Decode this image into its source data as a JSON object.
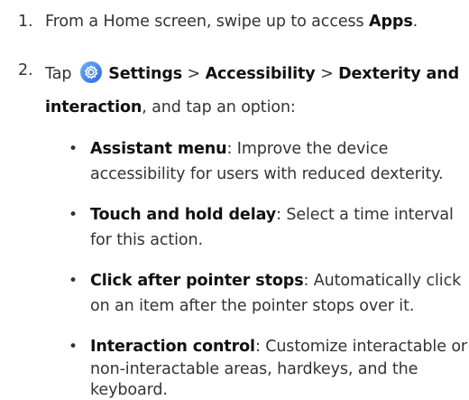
{
  "steps": [
    {
      "number": "1.",
      "text_before": "From a Home screen, swipe up to access ",
      "bold": "Apps",
      "text_after": "."
    },
    {
      "number": "2.",
      "tap": "Tap",
      "settings": "Settings",
      "sep1": ">",
      "accessibility": "Accessibility",
      "sep2": ">",
      "dexterity_line1": "Dexterity and",
      "dexterity_line2": "interaction",
      "tail": ", and tap an option:"
    }
  ],
  "icon": {
    "name": "settings-gear-icon",
    "color": "#3d7df6"
  },
  "options": [
    {
      "bullet": "•",
      "title": "Assistant menu",
      "lines": [
        ": Improve the device",
        "accessibility for users with reduced dexterity."
      ]
    },
    {
      "bullet": "•",
      "title": "Touch and hold delay",
      "lines": [
        ": Select a time interval",
        "for this action."
      ]
    },
    {
      "bullet": "•",
      "title": "Click after pointer stops",
      "lines": [
        ": Automatically click",
        "on an item after the pointer stops over it."
      ]
    },
    {
      "bullet": "•",
      "title": "Interaction control",
      "lines": [
        ": Customize interactable or",
        "non-interactable areas, hardkeys, and the",
        "keyboard."
      ]
    }
  ]
}
